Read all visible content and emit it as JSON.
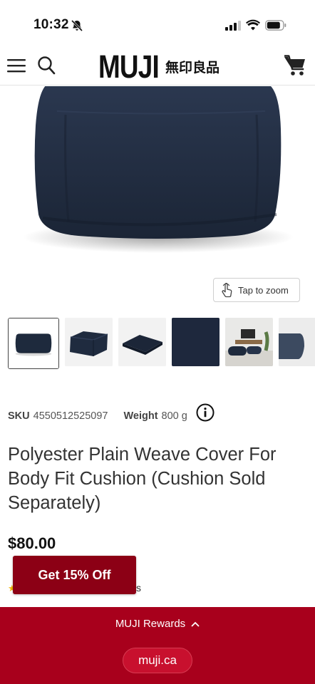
{
  "status_bar": {
    "time": "10:32",
    "icons": [
      "bell-slash-icon",
      "signal-icon",
      "wifi-icon",
      "battery-icon"
    ]
  },
  "header": {
    "logo_text": "MUJI",
    "logo_kanji": "無印良品",
    "icons": [
      "menu-icon",
      "search-icon",
      "cart-icon"
    ]
  },
  "gallery": {
    "zoom_label": "Tap to zoom",
    "thumbnails": [
      "cushion-front",
      "cushion-angle",
      "folded-cover",
      "fabric-swatch",
      "living-room",
      "cushion-side"
    ],
    "active_index": 0
  },
  "product": {
    "sku_label": "SKU",
    "sku_value": "4550512525097",
    "weight_label": "Weight",
    "weight_value": "800 g",
    "title": "Polyester Plain Weave Cover For Body Fit Cushion (Cushion Sold Separately)",
    "price": "$80.00",
    "rating_tail": "s"
  },
  "promo": {
    "label": "Get 15% Off"
  },
  "footer": {
    "rewards_label": "MUJI Rewards",
    "url": "muji.ca"
  },
  "colors": {
    "brand_red": "#a8001c",
    "promo_red": "#8c0015",
    "cushion_navy": "#1e2a3d"
  }
}
